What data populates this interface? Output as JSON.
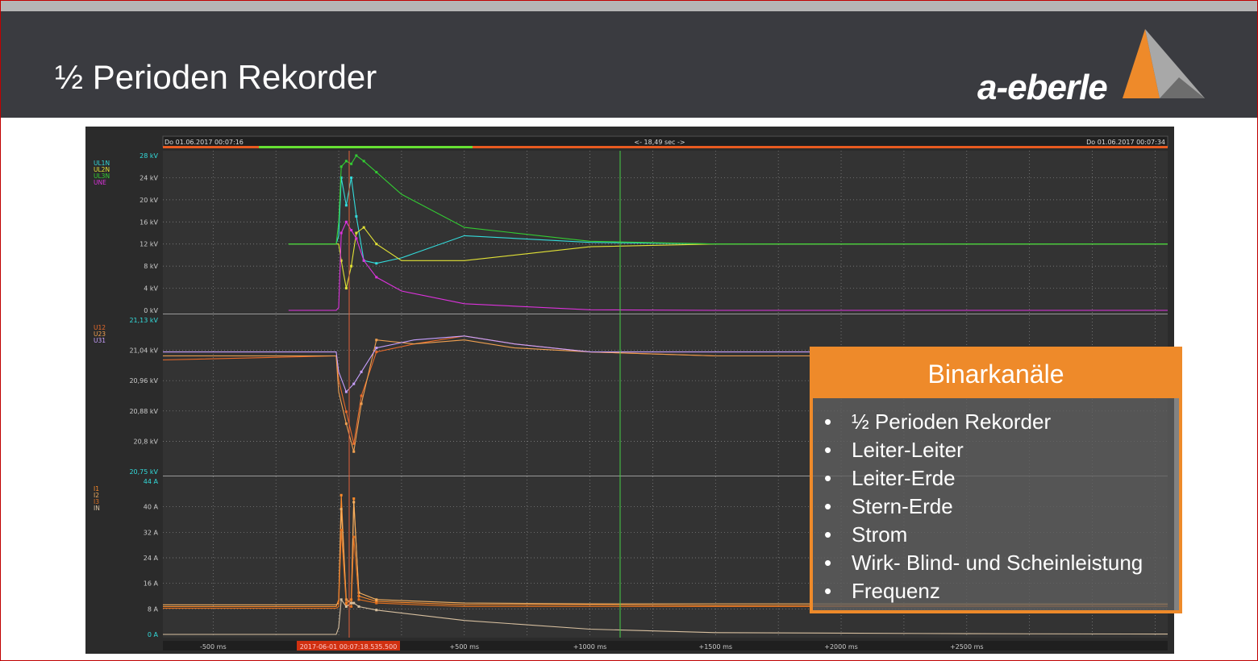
{
  "header": {
    "title": "½ Perioden Rekorder",
    "brand": "a-eberle"
  },
  "colors": {
    "header_bg": "#3a3b40",
    "accent": "#ee8a2a",
    "scope_bg": "#2b2b2b",
    "UL1N": "#33dcdc",
    "UL2N": "#e2e236",
    "UL3N": "#33cc33",
    "UNE": "#dd33dd",
    "U12": "#e86a2a",
    "U23": "#f0a050",
    "U31": "#c8a0ff",
    "I1": "#ff8c2a",
    "I2": "#f5b060",
    "I3": "#e07020",
    "IN": "#d8c0a0"
  },
  "scope": {
    "time_start": "Do 01.06.2017 00:07:16",
    "time_span": "<- 18,49 sec ->",
    "time_end": "Do 01.06.2017 00:07:34",
    "cursor_time": "2017-06-01 00:07:18.535.500",
    "x_ticks": [
      "-500 ms",
      "+500 ms",
      "+1000 ms",
      "+1500 ms",
      "+2000 ms",
      "+2500 ms"
    ],
    "panel_top_legend": [
      "UL1N",
      "UL2N",
      "UL3N",
      "UNE"
    ],
    "panel_top_ticks": [
      "28 kV",
      "24 kV",
      "20 kV",
      "16 kV",
      "12 kV",
      "8 kV",
      "4 kV",
      "0 kV"
    ],
    "panel_mid_legend": [
      "U12",
      "U23",
      "U31"
    ],
    "panel_mid_ticks": [
      "21,13 kV",
      "21,04 kV",
      "20,96 kV",
      "20,88 kV",
      "20,8 kV",
      "20,75 kV"
    ],
    "panel_bot_legend": [
      "I1",
      "I2",
      "I3",
      "IN"
    ],
    "panel_bot_ticks": [
      "44 A",
      "40 A",
      "32 A",
      "24 A",
      "16 A",
      "8 A",
      "0 A"
    ]
  },
  "chart_data": [
    {
      "type": "line",
      "title": "",
      "xlabel": "",
      "ylabel": "kV",
      "x_unit": "ms",
      "xlim": [
        -700,
        3300
      ],
      "ylim": [
        0,
        28
      ],
      "series": [
        {
          "name": "UL1N",
          "x": [
            -200,
            -10,
            0,
            10,
            30,
            50,
            70,
            100,
            150,
            250,
            500,
            1000,
            1500,
            3300
          ],
          "y": [
            12,
            12,
            13.5,
            24,
            19,
            24,
            17,
            9,
            8.5,
            9.5,
            13.5,
            12.3,
            12,
            12
          ]
        },
        {
          "name": "UL2N",
          "x": [
            -200,
            -10,
            0,
            10,
            30,
            50,
            70,
            100,
            150,
            250,
            500,
            1000,
            1500,
            3300
          ],
          "y": [
            12,
            12,
            12,
            9,
            4,
            8,
            14,
            15,
            12,
            9,
            9,
            11.5,
            12,
            12
          ]
        },
        {
          "name": "UL3N",
          "x": [
            -200,
            -10,
            0,
            10,
            30,
            50,
            70,
            100,
            150,
            250,
            500,
            1000,
            1500,
            3300
          ],
          "y": [
            12,
            12,
            16,
            26,
            27,
            26.5,
            28,
            27,
            25,
            21,
            15,
            12.5,
            12,
            12
          ]
        },
        {
          "name": "UNE",
          "x": [
            -200,
            -10,
            0,
            10,
            30,
            50,
            70,
            100,
            150,
            250,
            500,
            1000,
            1500,
            3300
          ],
          "y": [
            0,
            0,
            0.5,
            14,
            16,
            14.5,
            13,
            9,
            6,
            3.5,
            1.2,
            0.1,
            0,
            0
          ]
        }
      ]
    },
    {
      "type": "line",
      "title": "",
      "xlabel": "",
      "ylabel": "kV",
      "x_unit": "ms",
      "xlim": [
        -700,
        3300
      ],
      "ylim": [
        20.75,
        21.13
      ],
      "series": [
        {
          "name": "U12",
          "x": [
            -700,
            -10,
            0,
            30,
            60,
            90,
            150,
            300,
            500,
            700,
            1000,
            1500,
            2500,
            3300
          ],
          "y": [
            21.03,
            21.04,
            20.98,
            20.9,
            20.82,
            20.94,
            21.05,
            21.07,
            21.09,
            21.07,
            21.05,
            21.04,
            21.04,
            21.05
          ]
        },
        {
          "name": "U23",
          "x": [
            -700,
            -10,
            0,
            30,
            60,
            90,
            150,
            300,
            500,
            700,
            1000,
            1500,
            2500,
            3300
          ],
          "y": [
            21.04,
            21.04,
            20.95,
            20.87,
            20.8,
            20.92,
            21.08,
            21.07,
            21.08,
            21.06,
            21.05,
            21.04,
            21.04,
            21.05
          ]
        },
        {
          "name": "U31",
          "x": [
            -700,
            -10,
            0,
            30,
            60,
            90,
            150,
            300,
            500,
            700,
            1000,
            1500,
            2500,
            3300
          ],
          "y": [
            21.05,
            21.05,
            21.0,
            20.95,
            20.97,
            21.0,
            21.06,
            21.08,
            21.09,
            21.07,
            21.05,
            21.05,
            21.05,
            21.06
          ]
        }
      ]
    },
    {
      "type": "line",
      "title": "",
      "xlabel": "",
      "ylabel": "A",
      "x_unit": "ms",
      "xlim": [
        -700,
        3300
      ],
      "ylim": [
        0,
        44
      ],
      "series": [
        {
          "name": "I1",
          "x": [
            -700,
            -10,
            0,
            10,
            30,
            50,
            60,
            80,
            150,
            500,
            1000,
            1500,
            2500,
            3300
          ],
          "y": [
            8,
            8,
            10,
            40,
            9,
            10,
            39,
            11,
            9.5,
            8.5,
            8.5,
            8.3,
            8.4,
            8.5
          ]
        },
        {
          "name": "I2",
          "x": [
            -700,
            -10,
            0,
            10,
            30,
            50,
            60,
            80,
            150,
            500,
            1000,
            1500,
            2500,
            3300
          ],
          "y": [
            8.5,
            8.5,
            9,
            36,
            10,
            9,
            38,
            12,
            10,
            9,
            8.8,
            8.8,
            8.8,
            8.8
          ]
        },
        {
          "name": "I3",
          "x": [
            -700,
            -10,
            0,
            10,
            30,
            50,
            60,
            80,
            150,
            500,
            1000,
            1500,
            2500,
            3300
          ],
          "y": [
            7.5,
            7.5,
            8,
            30,
            8.5,
            8,
            28,
            10,
            9,
            8,
            8,
            8,
            8,
            8
          ]
        },
        {
          "name": "IN",
          "x": [
            -700,
            -10,
            0,
            10,
            30,
            50,
            60,
            80,
            150,
            500,
            1000,
            1500,
            2500,
            3300
          ],
          "y": [
            0,
            0,
            2,
            10,
            8,
            9,
            9,
            8,
            7,
            4,
            1.5,
            0.5,
            0.2,
            0.1
          ]
        }
      ]
    }
  ],
  "binary_panel": {
    "title": "Binarkanäle",
    "bullet": "•",
    "items": [
      "½ Perioden Rekorder",
      "Leiter-Leiter",
      "Leiter-Erde",
      "Stern-Erde",
      "Strom",
      "Wirk- Blind- und Scheinleistung",
      "Frequenz"
    ]
  }
}
